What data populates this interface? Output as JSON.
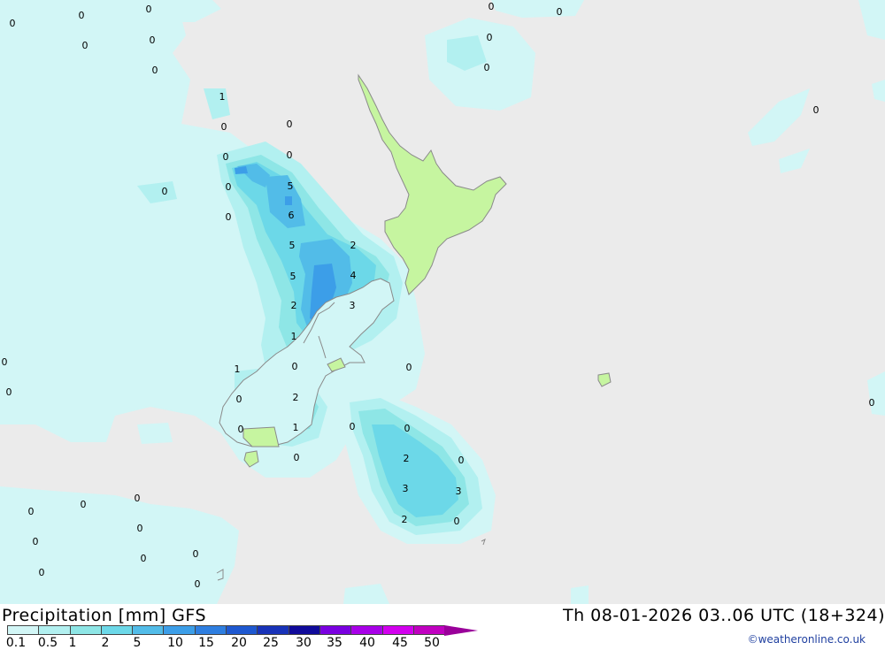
{
  "title": {
    "left": "Precipitation [mm] GFS",
    "right": "Th 08-01-2026 03..06 UTC (18+324)"
  },
  "legend": {
    "ticks": [
      "0.1",
      "0.5",
      "1",
      "2",
      "5",
      "10",
      "15",
      "20",
      "25",
      "30",
      "35",
      "40",
      "45",
      "50"
    ],
    "colors": [
      "#d2f6f6",
      "#b2f0f0",
      "#8ee6e6",
      "#6cd8e8",
      "#52bce8",
      "#3c9ee8",
      "#2e7ee0",
      "#1e58d0",
      "#1832b8",
      "#100a9a",
      "#7a00e0",
      "#a800e8",
      "#d200ee",
      "#c000c0"
    ],
    "arrow_color": "#9a009a"
  },
  "credit": "©weatheronline.co.uk",
  "map": {
    "background": "#ebebeb",
    "land_color": "#c6f5a0",
    "labels": [
      {
        "text": "0"
      },
      {
        "text": "0"
      },
      {
        "text": "0"
      },
      {
        "text": "0"
      },
      {
        "text": "0"
      },
      {
        "text": "0"
      },
      {
        "text": "0"
      },
      {
        "text": "0"
      },
      {
        "text": "0"
      },
      {
        "text": "1"
      },
      {
        "text": "0"
      },
      {
        "text": "0"
      },
      {
        "text": "0"
      },
      {
        "text": "0"
      },
      {
        "text": "0"
      },
      {
        "text": "0"
      },
      {
        "text": "5"
      },
      {
        "text": "6"
      },
      {
        "text": "0"
      },
      {
        "text": "0"
      },
      {
        "text": "5"
      },
      {
        "text": "2"
      },
      {
        "text": "5"
      },
      {
        "text": "4"
      },
      {
        "text": "2"
      },
      {
        "text": "3"
      },
      {
        "text": "1"
      },
      {
        "text": "0"
      },
      {
        "text": "1"
      },
      {
        "text": "0"
      },
      {
        "text": "0"
      },
      {
        "text": "0"
      },
      {
        "text": "2"
      },
      {
        "text": "0"
      },
      {
        "text": "0"
      },
      {
        "text": "1"
      },
      {
        "text": "0"
      },
      {
        "text": "0"
      },
      {
        "text": "0"
      },
      {
        "text": "2"
      },
      {
        "text": "0"
      },
      {
        "text": "3"
      },
      {
        "text": "3"
      },
      {
        "text": "2"
      },
      {
        "text": "0"
      },
      {
        "text": "0"
      },
      {
        "text": "0"
      },
      {
        "text": "0"
      },
      {
        "text": "0"
      },
      {
        "text": "0"
      },
      {
        "text": "0"
      },
      {
        "text": "0"
      },
      {
        "text": "0"
      },
      {
        "text": "0"
      },
      {
        "text": "0"
      },
      {
        "text": "0"
      }
    ]
  }
}
